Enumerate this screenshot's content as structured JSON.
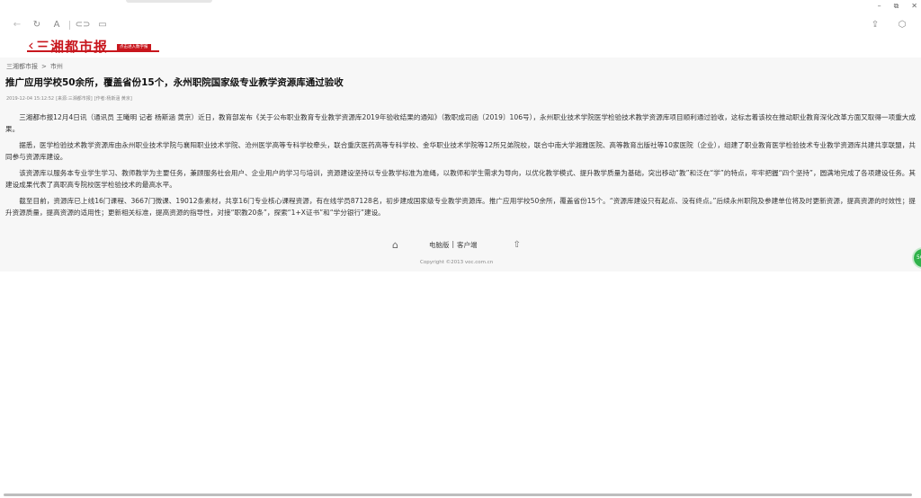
{
  "window": {
    "controls": [
      "–",
      "⧉",
      "✕"
    ]
  },
  "toolbar": {
    "font_label": "A"
  },
  "masthead": {
    "back_glyph": "‹",
    "brand": "三湘都市报",
    "tag": "点击进入数字报"
  },
  "breadcrumb": {
    "home": "三湘都市报",
    "separator": ">",
    "section": "市州"
  },
  "article": {
    "title": "推广应用学校50余所，覆盖省份15个，永州职院国家级专业教学资源库通过验收",
    "date": "2019-12-04 15:12:52",
    "source": "[来源:三湘都市报]",
    "author": "[作者:杨斯涵 黄京]",
    "paragraphs": [
      "三湘都市报12月4日讯（通讯员 王曦明 记者 杨斯涵 黄京）近日，教育部发布《关于公布职业教育专业教学资源库2019年验收结果的通知》（教职成司函〔2019〕106号），永州职业技术学院医学检验技术教学资源库项目顺利通过验收，这标志着该校在推动职业教育深化改革方面又取得一项重大成果。",
      "据悉，医学检验技术教学资源库由永州职业技术学院与襄阳职业技术学院、沧州医学高等专科学校牵头，联合重庆医药高等专科学校、金华职业技术学院等12所兄弟院校，联合中南大学湘雅医院、高等教育出版社等10家医院（企业），组建了职业教育医学检验技术专业教学资源库共建共享联盟，共同参与资源库建设。",
      "该资源库以服务本专业学生学习、教师教学为主要任务，兼顾服务社会用户、企业用户的学习与培训，资源建设坚持以专业教学标准为准绳，以教师和学生需求为导向，以优化教学模式、提升教学质量为基础，突出移动“教”和泛在“学”的特点，牢牢把握“四个坚持”，圆满地完成了各项建设任务。其建设成果代表了高职高专院校医学检验技术的最高水平。",
      "截至目前，资源库已上线16门课程、3667门微课、19012条素材，共享16门专业核心课程资源，有在线学员87128名，初步建成国家级专业教学资源库。推广应用学校50余所，覆盖省份15个。“资源库建设只有起点、没有终点。”后续永州职院及参建单位将及时更新资源，提高资源的时效性；提升资源质量，提高资源的适用性；更新相关标准，提高资源的指导性，对接“职教20条”，探索“1+X证书”和“学分银行”建设。"
    ]
  },
  "float_button": {
    "label": "56"
  },
  "footer": {
    "desktop_link": "电脑版",
    "divider": "|",
    "client_link": "客户端",
    "copyright": "Copyright ©2013 voc.com.cn"
  },
  "colors": {
    "brand_red": "#c8161d",
    "float_green": "#2fb24a"
  }
}
